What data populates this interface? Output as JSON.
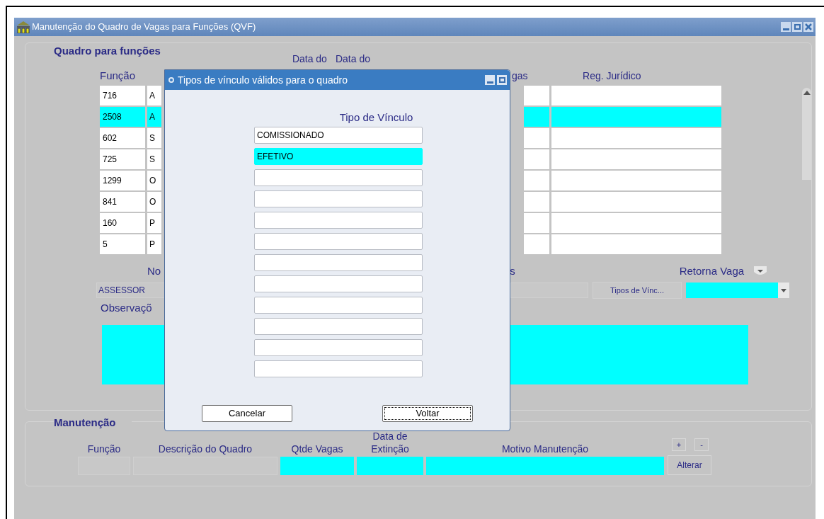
{
  "window": {
    "title": "Manutenção do Quadro de Vagas para Funções (QVF)"
  },
  "quadro": {
    "title": "Quadro para funções",
    "header_funcao": "Função",
    "header_date_1": "Data do",
    "header_date_2": "Data do",
    "header_vagas": "gas",
    "header_reg": "Reg. Jurídico",
    "rows": [
      {
        "funcao": "716",
        "descricao": "A",
        "selected": false
      },
      {
        "funcao": "2508",
        "descricao": "A",
        "selected": true
      },
      {
        "funcao": "602",
        "descricao": "S",
        "selected": false
      },
      {
        "funcao": "725",
        "descricao": "S",
        "selected": false
      },
      {
        "funcao": "1299",
        "descricao": "O",
        "selected": false
      },
      {
        "funcao": "841",
        "descricao": "O",
        "selected": false
      },
      {
        "funcao": "160",
        "descricao": "P",
        "selected": false
      },
      {
        "funcao": "5",
        "descricao": "P",
        "selected": false
      }
    ],
    "nome_label": "No",
    "nome_value": "ASSESSOR",
    "tipos_label": "s",
    "tipos_button": "Tipos de Vínc...",
    "retorna_label": "Retorna Vaga",
    "observacoes_label": "Observaçõ"
  },
  "dialog": {
    "title": "Tipos de vínculo válidos para o quadro",
    "column": "Tipo de Vínculo",
    "items": [
      {
        "value": "COMISSIONADO",
        "selected": false
      },
      {
        "value": "EFETIVO",
        "selected": true
      },
      {
        "selected": false
      },
      {
        "selected": false
      },
      {
        "selected": false
      },
      {
        "selected": false
      },
      {
        "selected": false
      },
      {
        "selected": false
      },
      {
        "selected": false
      },
      {
        "selected": false
      },
      {
        "selected": false
      },
      {
        "selected": false
      }
    ],
    "buttons": [
      {
        "label": "Cancelar",
        "focused": false
      },
      {
        "label": "Voltar",
        "focused": true
      }
    ]
  },
  "manutencao": {
    "title": "Manutenção",
    "add_button": "+",
    "remove_button": "-",
    "alter_button": "Alterar",
    "fields": [
      {
        "label": "Função",
        "required": false
      },
      {
        "label": "Descrição do Quadro",
        "required": false
      },
      {
        "label": "Qtde  Vagas",
        "required": true
      },
      {
        "label": "Data de Extinção",
        "required": true
      },
      {
        "label": "Motivo Manutenção",
        "required": true
      }
    ]
  }
}
